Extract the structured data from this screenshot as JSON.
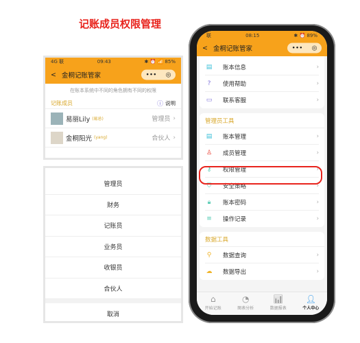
{
  "title": "记账成员权限管理",
  "left_top": {
    "status": {
      "carrier": "4G 联",
      "time": "09:43",
      "icons": "✱ ⏰ 📶 85%"
    },
    "nav": {
      "back": "<",
      "title": "金桐记账管家",
      "more": "•••",
      "target": "◎"
    },
    "subtitle": "在账本系统中不同的角色拥有不同的权限",
    "section": "记账成员",
    "help_label": "说明",
    "members": [
      {
        "name": "易丽Lily",
        "nick": "(易总)",
        "role": "管理员"
      },
      {
        "name": "金桐阳光",
        "nick": "(yang)",
        "role": "合伙人"
      }
    ]
  },
  "sheet": {
    "options": [
      "管理员",
      "财务",
      "记账员",
      "业务员",
      "收银员",
      "合伙人"
    ],
    "cancel": "取消"
  },
  "phone": {
    "status": {
      "carrier": "联",
      "time": "08:15",
      "icons": "✱ ⏰ 89%"
    },
    "nav": {
      "back": "<",
      "title": "金桐记账管家",
      "more": "•••",
      "target": "◎"
    },
    "group1": [
      {
        "icon": "book-icon",
        "label": "账本信息",
        "color": "#3cc0d8"
      },
      {
        "icon": "help-icon",
        "label": "使用帮助",
        "color": "#7b6fd8"
      },
      {
        "icon": "chat-icon",
        "label": "联系客服",
        "color": "#7b6fd8"
      }
    ],
    "admin_title": "管理员工具",
    "admin": [
      {
        "icon": "ledger-icon",
        "label": "账本管理",
        "color": "#3cc0d8"
      },
      {
        "icon": "user-icon",
        "label": "成员管理",
        "color": "#e8392c"
      },
      {
        "icon": "key-icon",
        "label": "权限管理",
        "color": "#4fc9b0"
      },
      {
        "icon": "shield-icon",
        "label": "安全策略",
        "color": "#4fc9b0"
      },
      {
        "icon": "lock-icon",
        "label": "账本密码",
        "color": "#4fc9b0"
      },
      {
        "icon": "list-icon",
        "label": "操作记录",
        "color": "#4fc9b0"
      }
    ],
    "data_title": "数据工具",
    "data": [
      {
        "icon": "search-icon",
        "label": "数据查询",
        "color": "#f0b429"
      },
      {
        "icon": "cloud-icon",
        "label": "数据导出",
        "color": "#f0b429"
      }
    ],
    "tabs": [
      {
        "icon": "home-icon",
        "label": "开始记账"
      },
      {
        "icon": "pie-icon",
        "label": "图表分析"
      },
      {
        "icon": "bar-chart-icon",
        "label": "数据报表"
      },
      {
        "icon": "person-icon",
        "label": "个人中心",
        "active": true
      }
    ],
    "highlight_color": "#e8231c"
  }
}
